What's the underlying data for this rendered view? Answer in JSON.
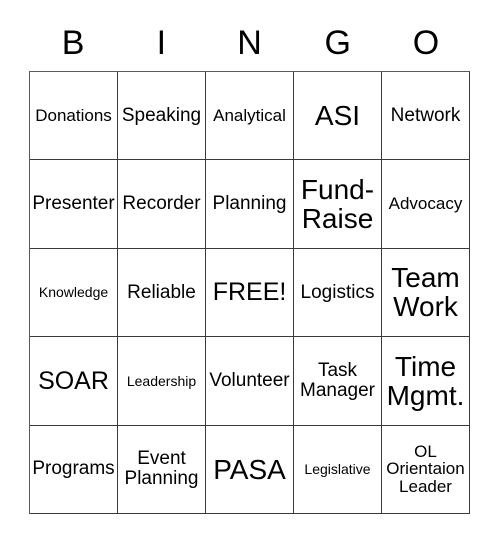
{
  "card": {
    "header_letters": [
      "B",
      "I",
      "N",
      "G",
      "O"
    ],
    "columns": 5,
    "rows": 5,
    "grid_line_color": "#3a3a3a",
    "background_color": "#ffffff",
    "text_color": "#000000",
    "free_space": "FREE!",
    "cells": [
      [
        {
          "text": "Donations",
          "size": "sm"
        },
        {
          "text": "Speaking",
          "size": "md"
        },
        {
          "text": "Analytical",
          "size": "sm"
        },
        {
          "text": "ASI",
          "size": "xl"
        },
        {
          "text": "Network",
          "size": "md"
        }
      ],
      [
        {
          "text": "Presenter",
          "size": "md"
        },
        {
          "text": "Recorder",
          "size": "md"
        },
        {
          "text": "Planning",
          "size": "md"
        },
        {
          "text": "Fund-\nRaise",
          "size": "xl"
        },
        {
          "text": "Advocacy",
          "size": "sm"
        }
      ],
      [
        {
          "text": "Knowledge",
          "size": "xs"
        },
        {
          "text": "Reliable",
          "size": "md"
        },
        {
          "text": "FREE!",
          "size": "lg"
        },
        {
          "text": "Logistics",
          "size": "md"
        },
        {
          "text": "Team\nWork",
          "size": "xl"
        }
      ],
      [
        {
          "text": "SOAR",
          "size": "lg"
        },
        {
          "text": "Leadership",
          "size": "xs"
        },
        {
          "text": "Volunteer",
          "size": "md"
        },
        {
          "text": "Task\nManager",
          "size": "md"
        },
        {
          "text": "Time\nMgmt.",
          "size": "xl"
        }
      ],
      [
        {
          "text": "Programs",
          "size": "md"
        },
        {
          "text": "Event\nPlanning",
          "size": "md"
        },
        {
          "text": "PASA",
          "size": "xl"
        },
        {
          "text": "Legislative",
          "size": "xs"
        },
        {
          "text": "OL\nOrientaion\nLeader",
          "size": "sm"
        }
      ]
    ]
  }
}
